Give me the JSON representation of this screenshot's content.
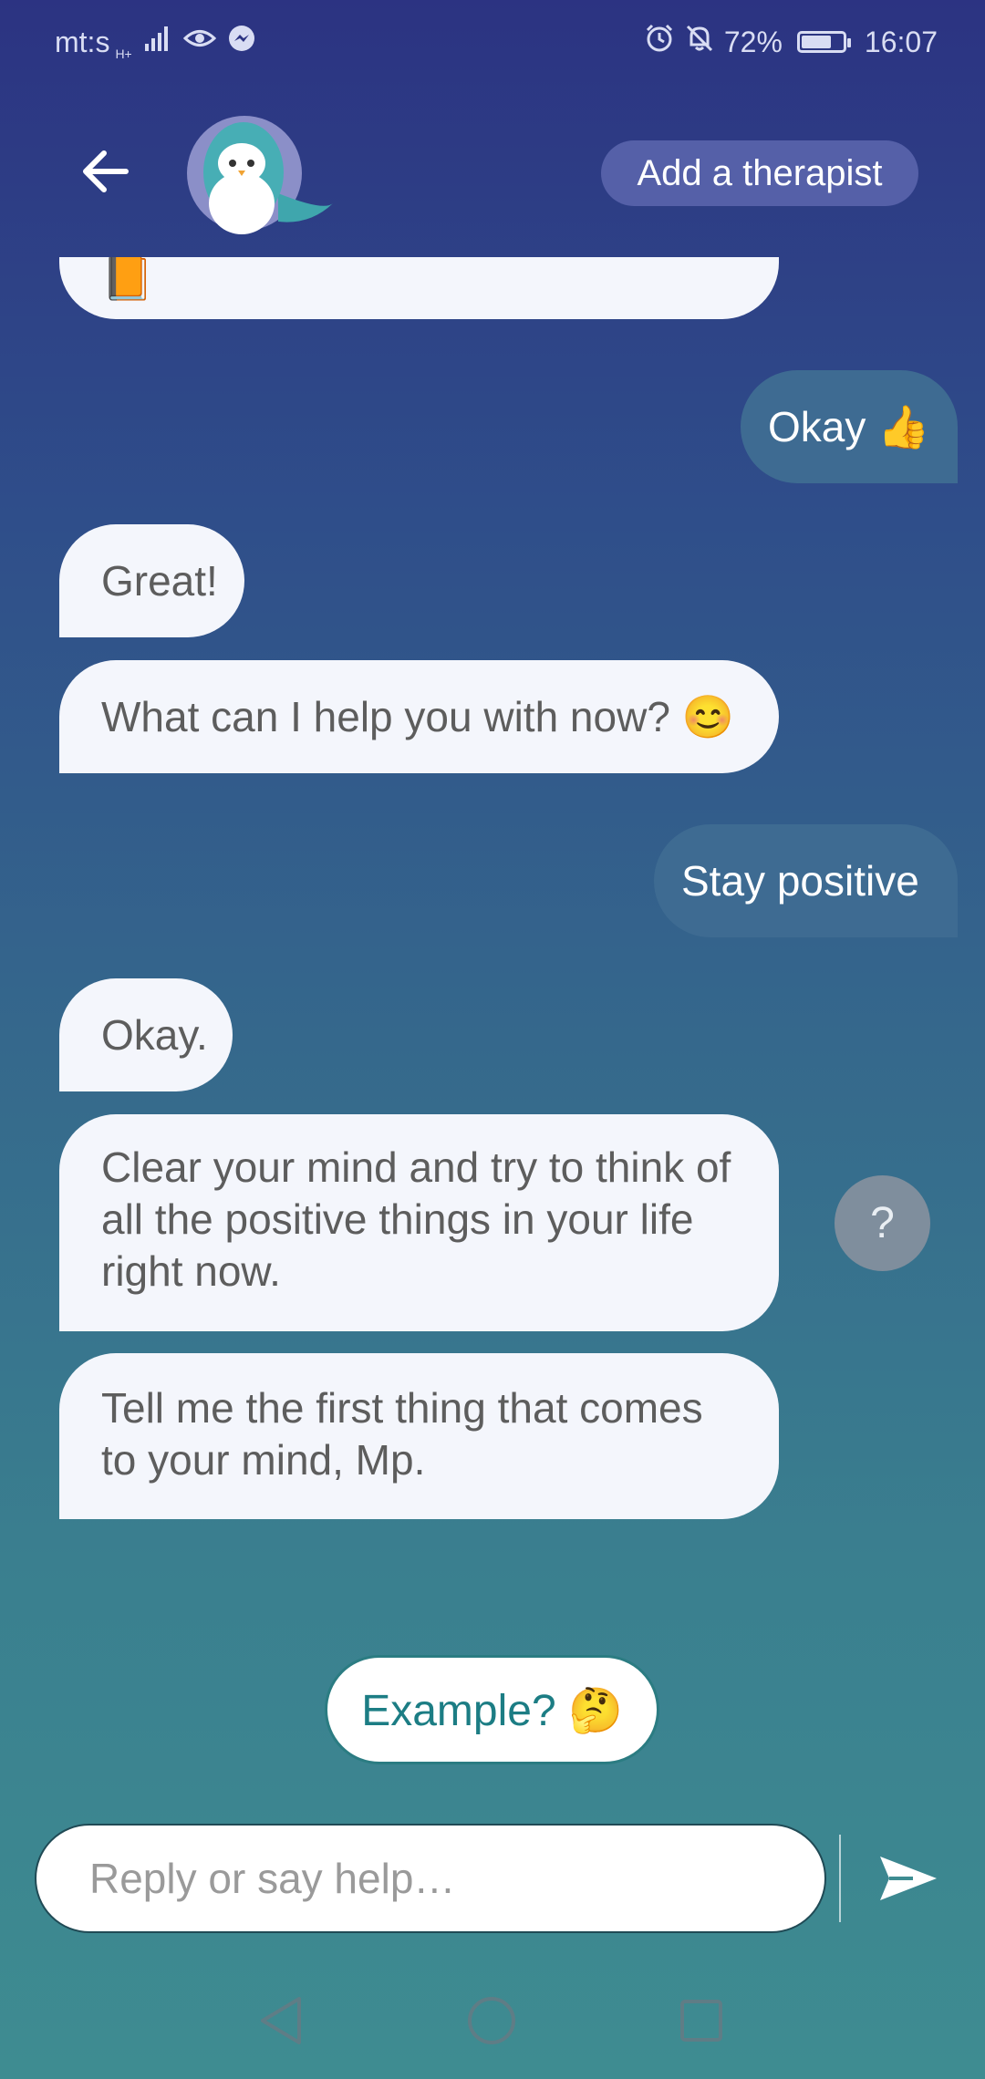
{
  "status_bar": {
    "carrier": "mt:s",
    "network": "H+",
    "battery_percent": "72%",
    "battery_level": 0.72,
    "time": "16:07",
    "icons": [
      "signal-icon",
      "eye-icon",
      "messenger-icon",
      "alarm-icon",
      "notifications-off-icon",
      "battery-icon"
    ]
  },
  "header": {
    "back_icon": "arrow-left-icon",
    "avatar_icon": "penguin-avatar-icon",
    "add_therapist_label": "Add a therapist"
  },
  "messages": [
    {
      "from": "bot",
      "text": "📙"
    },
    {
      "from": "user",
      "text": "Okay 👍"
    },
    {
      "from": "bot",
      "text": "Great!"
    },
    {
      "from": "bot",
      "text": "What can I help you with now? 😊"
    },
    {
      "from": "user",
      "text": "Stay positive"
    },
    {
      "from": "bot",
      "text": "Okay."
    },
    {
      "from": "bot",
      "text": "Clear your mind and try to think of all the positive things in your life right now."
    },
    {
      "from": "bot",
      "text": "Tell me the first thing that comes to your mind, Mp."
    }
  ],
  "help_button_label": "?",
  "suggestion": {
    "label": "Example? 🤔"
  },
  "composer": {
    "placeholder": "Reply or say help…",
    "send_icon": "send-icon"
  },
  "nav_bar": {
    "icons": [
      "back-triangle-icon",
      "home-circle-icon",
      "recents-square-icon"
    ]
  },
  "colors": {
    "gradient_top": "#2c3382",
    "gradient_bottom": "#3e8c91",
    "bot_bubble": "#f4f6fc",
    "user_bubble": "#3e6b92",
    "accent_teal": "#1c7d84",
    "therapist_button": "#5560a8"
  }
}
